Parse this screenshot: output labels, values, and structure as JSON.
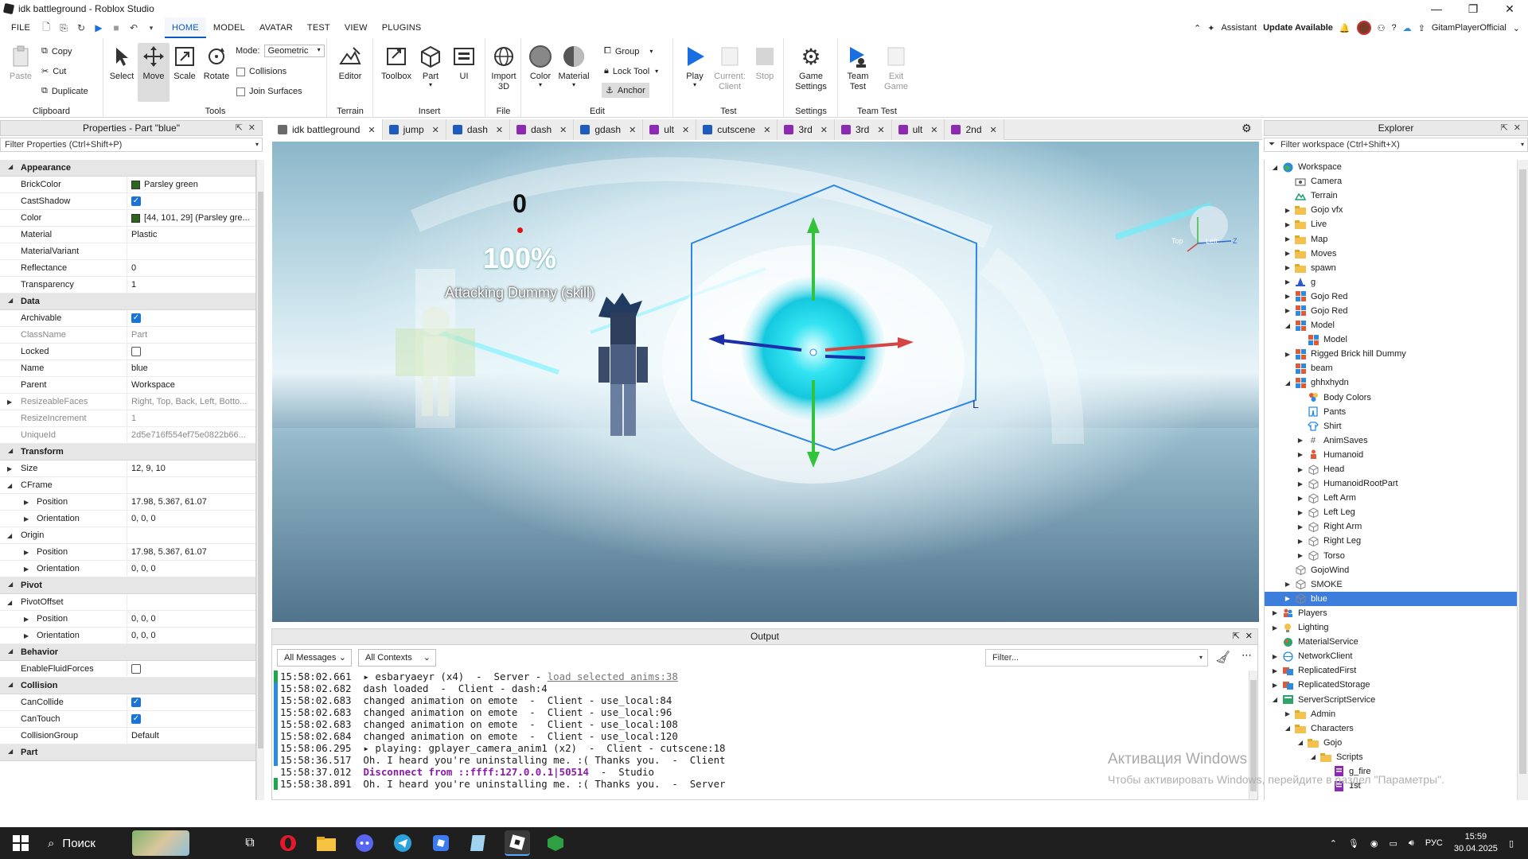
{
  "window": {
    "title": "idk battleground - Roblox Studio",
    "minimize": "—",
    "maximize": "❐",
    "close": "✕"
  },
  "menu": {
    "file": "FILE",
    "tabs": [
      "HOME",
      "MODEL",
      "AVATAR",
      "TEST",
      "VIEW",
      "PLUGINS"
    ],
    "active_tab": "HOME",
    "assistant": "Assistant",
    "update": "Update Available",
    "username": "GitamPlayerOfficial"
  },
  "ribbon": {
    "clipboard": {
      "paste": "Paste",
      "copy": "Copy",
      "cut": "Cut",
      "duplicate": "Duplicate",
      "label": "Clipboard"
    },
    "tools": {
      "select": "Select",
      "move": "Move",
      "scale": "Scale",
      "rotate": "Rotate",
      "mode_label": "Mode:",
      "mode_value": "Geometric",
      "collisions": "Collisions",
      "join_surfaces": "Join Surfaces",
      "label": "Tools"
    },
    "terrain": {
      "editor": "Editor",
      "label": "Terrain"
    },
    "insert": {
      "toolbox": "Toolbox",
      "part": "Part",
      "ui": "UI",
      "label": "Insert"
    },
    "file": {
      "import3d": "Import 3D",
      "label": "File"
    },
    "edit": {
      "color": "Color",
      "material": "Material",
      "group": "Group",
      "lock_tool": "Lock Tool",
      "anchor": "Anchor",
      "label": "Edit"
    },
    "test": {
      "play": "Play",
      "current_client": "Current: Client",
      "stop": "Stop",
      "label": "Test"
    },
    "settings": {
      "game_settings": "Game Settings",
      "label": "Settings"
    },
    "team_test": {
      "team_test": "Team Test",
      "exit_game": "Exit Game",
      "label": "Team Test"
    }
  },
  "properties": {
    "header": "Properties - Part \"blue\"",
    "filter_placeholder": "Filter Properties (Ctrl+Shift+P)",
    "rows": [
      {
        "type": "cat",
        "name": "Appearance"
      },
      {
        "name": "BrickColor",
        "value": "Parsley green",
        "swatch": true
      },
      {
        "name": "CastShadow",
        "check": true
      },
      {
        "name": "Color",
        "value": "[44, 101, 29] (Parsley gre...",
        "swatch": true
      },
      {
        "name": "Material",
        "value": "Plastic"
      },
      {
        "name": "MaterialVariant",
        "value": ""
      },
      {
        "name": "Reflectance",
        "value": "0"
      },
      {
        "name": "Transparency",
        "value": "1"
      },
      {
        "type": "cat",
        "name": "Data"
      },
      {
        "name": "Archivable",
        "check": true
      },
      {
        "name": "ClassName",
        "value": "Part",
        "grey": true
      },
      {
        "name": "Locked",
        "check": false
      },
      {
        "name": "Name",
        "value": "blue"
      },
      {
        "name": "Parent",
        "value": "Workspace"
      },
      {
        "name": "ResizeableFaces",
        "value": "Right, Top, Back, Left, Botto...",
        "grey": true,
        "arrow": true
      },
      {
        "name": "ResizeIncrement",
        "value": "1",
        "grey": true
      },
      {
        "name": "UniqueId",
        "value": "2d5e716f554ef75e0822b66...",
        "grey": true
      },
      {
        "type": "cat",
        "name": "Transform"
      },
      {
        "name": "Size",
        "value": "12, 9, 10",
        "arrow": true
      },
      {
        "name": "CFrame",
        "value": "",
        "arrow": true,
        "open": true
      },
      {
        "name": "Position",
        "value": "17.98, 5.367, 61.07",
        "arrow": true,
        "indent": true
      },
      {
        "name": "Orientation",
        "value": "0, 0, 0",
        "arrow": true,
        "indent": true
      },
      {
        "name": "Origin",
        "value": "",
        "arrow": true,
        "open": true
      },
      {
        "name": "Position",
        "value": "17.98, 5.367, 61.07",
        "arrow": true,
        "indent": true
      },
      {
        "name": "Orientation",
        "value": "0, 0, 0",
        "arrow": true,
        "indent": true
      },
      {
        "type": "cat",
        "name": "Pivot"
      },
      {
        "name": "PivotOffset",
        "value": "",
        "arrow": true,
        "open": true
      },
      {
        "name": "Position",
        "value": "0, 0, 0",
        "arrow": true,
        "indent": true
      },
      {
        "name": "Orientation",
        "value": "0, 0, 0",
        "arrow": true,
        "indent": true
      },
      {
        "type": "cat",
        "name": "Behavior"
      },
      {
        "name": "EnableFluidForces",
        "check": false
      },
      {
        "type": "cat",
        "name": "Collision"
      },
      {
        "name": "CanCollide",
        "check": true
      },
      {
        "name": "CanTouch",
        "check": true
      },
      {
        "name": "CollisionGroup",
        "value": "Default"
      },
      {
        "type": "cat",
        "name": "Part"
      }
    ]
  },
  "tabs": [
    {
      "label": "idk battleground",
      "color": "#6b6b6b",
      "active": true
    },
    {
      "label": "jump",
      "color": "#1d5bbf"
    },
    {
      "label": "dash",
      "color": "#1d5bbf"
    },
    {
      "label": "dash",
      "color": "#8b2bb3"
    },
    {
      "label": "gdash",
      "color": "#1d5bbf"
    },
    {
      "label": "ult",
      "color": "#8b2bb3"
    },
    {
      "label": "cutscene",
      "color": "#1d5bbf"
    },
    {
      "label": "3rd",
      "color": "#8b2bb3"
    },
    {
      "label": "3rd",
      "color": "#8b2bb3"
    },
    {
      "label": "ult",
      "color": "#8b2bb3"
    },
    {
      "label": "2nd",
      "color": "#8b2bb3"
    }
  ],
  "viewport": {
    "score": "0",
    "percent": "100%",
    "attacking": "Attacking Dummy (skill)",
    "cube_top": "Top",
    "cube_left": "Left",
    "z_label": "Z"
  },
  "output": {
    "header": "Output",
    "all_messages": "All Messages",
    "all_contexts": "All Contexts",
    "filter_placeholder": "Filter...",
    "lines": [
      {
        "bar": "#1aa84b",
        "text": "15:58:02.661  ▸ esbaryaeyr (x4)  -  Server - ",
        "link": "load selected anims:38"
      },
      {
        "bar": "#2a8be0",
        "text": "15:58:02.682  dash loaded  -  Client - dash:4"
      },
      {
        "bar": "#2a8be0",
        "text": "15:58:02.683  changed animation on emote  -  Client - use_local:84"
      },
      {
        "bar": "#2a8be0",
        "text": "15:58:02.683  changed animation on emote  -  Client - use_local:96"
      },
      {
        "bar": "#2a8be0",
        "text": "15:58:02.683  changed animation on emote  -  Client - use_local:108"
      },
      {
        "bar": "#2a8be0",
        "text": "15:58:02.684  changed animation on emote  -  Client - use_local:120"
      },
      {
        "bar": "#2a8be0",
        "text": "15:58:06.295  ▸ playing: gplayer_camera_anim1 (x2)  -  Client - cutscene:18"
      },
      {
        "bar": "#2a8be0",
        "text": "15:58:36.517  Oh. I heard you're uninstalling me. :( Thanks you.  -  Client"
      },
      {
        "bar": "",
        "text": "15:58:37.012  ",
        "purple": "Disconnect from ::ffff:127.0.0.1|50514",
        "after": "  -  Studio"
      },
      {
        "bar": "#1aa84b",
        "text": "15:58:38.891  Oh. I heard you're uninstalling me. :( Thanks you.  -  Server"
      }
    ]
  },
  "explorer": {
    "header": "Explorer",
    "filter_placeholder": "Filter workspace (Ctrl+Shift+X)",
    "items": [
      {
        "label": "Workspace",
        "depth": 0,
        "arrow": "open",
        "icon": "globe"
      },
      {
        "label": "Camera",
        "depth": 1,
        "arrow": "",
        "icon": "camera"
      },
      {
        "label": "Terrain",
        "depth": 1,
        "arrow": "",
        "icon": "terrain"
      },
      {
        "label": "Gojo vfx",
        "depth": 1,
        "arrow": "closed",
        "icon": "folder"
      },
      {
        "label": "Live",
        "depth": 1,
        "arrow": "closed",
        "icon": "folder"
      },
      {
        "label": "Map",
        "depth": 1,
        "arrow": "closed",
        "icon": "folder"
      },
      {
        "label": "Moves",
        "depth": 1,
        "arrow": "closed",
        "icon": "folder"
      },
      {
        "label": "spawn",
        "depth": 1,
        "arrow": "closed",
        "icon": "folder"
      },
      {
        "label": "g",
        "depth": 1,
        "arrow": "closed",
        "icon": "hat"
      },
      {
        "label": "Gojo Red",
        "depth": 1,
        "arrow": "closed",
        "icon": "model"
      },
      {
        "label": "Gojo Red",
        "depth": 1,
        "arrow": "closed",
        "icon": "model"
      },
      {
        "label": "Model",
        "depth": 1,
        "arrow": "open",
        "icon": "model"
      },
      {
        "label": "Model",
        "depth": 2,
        "arrow": "",
        "icon": "model"
      },
      {
        "label": "Rigged Brick hill Dummy",
        "depth": 1,
        "arrow": "closed",
        "icon": "model"
      },
      {
        "label": "beam",
        "depth": 1,
        "arrow": "",
        "icon": "model"
      },
      {
        "label": "ghhxhydn",
        "depth": 1,
        "arrow": "open",
        "icon": "model"
      },
      {
        "label": "Body Colors",
        "depth": 2,
        "arrow": "",
        "icon": "colors"
      },
      {
        "label": "Pants",
        "depth": 2,
        "arrow": "",
        "icon": "pants"
      },
      {
        "label": "Shirt",
        "depth": 2,
        "arrow": "",
        "icon": "shirt"
      },
      {
        "label": "AnimSaves",
        "depth": 2,
        "arrow": "closed",
        "icon": "hash"
      },
      {
        "label": "Humanoid",
        "depth": 2,
        "arrow": "closed",
        "icon": "humanoid"
      },
      {
        "label": "Head",
        "depth": 2,
        "arrow": "closed",
        "icon": "part"
      },
      {
        "label": "HumanoidRootPart",
        "depth": 2,
        "arrow": "closed",
        "icon": "part"
      },
      {
        "label": "Left Arm",
        "depth": 2,
        "arrow": "closed",
        "icon": "part"
      },
      {
        "label": "Left Leg",
        "depth": 2,
        "arrow": "closed",
        "icon": "part"
      },
      {
        "label": "Right Arm",
        "depth": 2,
        "arrow": "closed",
        "icon": "part"
      },
      {
        "label": "Right Leg",
        "depth": 2,
        "arrow": "closed",
        "icon": "part"
      },
      {
        "label": "Torso",
        "depth": 2,
        "arrow": "closed",
        "icon": "part"
      },
      {
        "label": "GojoWind",
        "depth": 1,
        "arrow": "",
        "icon": "part"
      },
      {
        "label": "SMOKE",
        "depth": 1,
        "arrow": "closed",
        "icon": "part"
      },
      {
        "label": "blue",
        "depth": 1,
        "arrow": "closed",
        "icon": "part",
        "selected": true
      },
      {
        "label": "Players",
        "depth": 0,
        "arrow": "closed",
        "icon": "players"
      },
      {
        "label": "Lighting",
        "depth": 0,
        "arrow": "closed",
        "icon": "bulb"
      },
      {
        "label": "MaterialService",
        "depth": 0,
        "arrow": "",
        "icon": "material"
      },
      {
        "label": "NetworkClient",
        "depth": 0,
        "arrow": "closed",
        "icon": "network"
      },
      {
        "label": "ReplicatedFirst",
        "depth": 0,
        "arrow": "closed",
        "icon": "replicated"
      },
      {
        "label": "ReplicatedStorage",
        "depth": 0,
        "arrow": "closed",
        "icon": "replicated"
      },
      {
        "label": "ServerScriptService",
        "depth": 0,
        "arrow": "open",
        "icon": "sss"
      },
      {
        "label": "Admin",
        "depth": 1,
        "arrow": "closed",
        "icon": "folder"
      },
      {
        "label": "Characters",
        "depth": 1,
        "arrow": "open",
        "icon": "folder"
      },
      {
        "label": "Gojo",
        "depth": 2,
        "arrow": "open",
        "icon": "folder"
      },
      {
        "label": "Scripts",
        "depth": 3,
        "arrow": "open",
        "icon": "folder"
      },
      {
        "label": "g_fire",
        "depth": 4,
        "arrow": "",
        "icon": "script"
      },
      {
        "label": "1st",
        "depth": 4,
        "arrow": "",
        "icon": "script"
      }
    ]
  },
  "watermark": {
    "line1": "Активация Windows",
    "line2": "Чтобы активировать Windows, перейдите в раздел \"Параметры\"."
  },
  "taskbar": {
    "search": "Поиск",
    "lang": "РУС",
    "time": "15:59",
    "date": "30.04.2025"
  }
}
